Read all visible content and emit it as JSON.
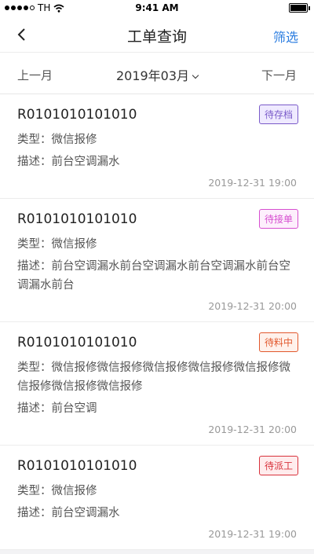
{
  "status": {
    "carrier": "TH",
    "time": "9:41 AM"
  },
  "nav": {
    "title": "工单查询",
    "filter_label": "筛选"
  },
  "monthbar": {
    "prev_label": "上一月",
    "current": "2019年03月",
    "next_label": "下一月"
  },
  "orders": [
    {
      "id": "R0101010101010",
      "status": "待存档",
      "type": "类型：微信报修",
      "desc": "描述：前台空调漏水",
      "time": "2019-12-31 19:00",
      "color": "#7a5bc9"
    },
    {
      "id": "R0101010101010",
      "status": "待接单",
      "type": "类型：微信报修",
      "desc": "描述：前台空调漏水前台空调漏水前台空调漏水前台空调漏水前台",
      "time": "2019-12-31 20:00",
      "color": "#d64fd0"
    },
    {
      "id": "R0101010101010",
      "status": "待料中",
      "type": "类型：微信报修微信报修微信报修微信报修微信报修微信报修微信报修微信报修",
      "desc": "描述：前台空调",
      "time": "2019-12-31 20:00",
      "color": "#e2582d"
    },
    {
      "id": "R0101010101010",
      "status": "待派工",
      "type": "类型：微信报修",
      "desc": "描述：前台空调漏水",
      "time": "2019-12-31 19:00",
      "color": "#d8323c"
    }
  ]
}
